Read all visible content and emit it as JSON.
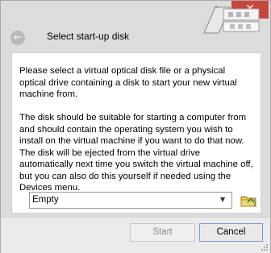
{
  "titlebar": {
    "help_label": "?",
    "close_label": "✕",
    "close_color": "#c7463d"
  },
  "header": {
    "back_icon": "back-arrow-icon",
    "title": "Select start-up disk"
  },
  "body": {
    "paragraph1": "Please select a virtual optical disk file or a physical optical drive containing a disk to start your new virtual machine from.",
    "paragraph2": "The disk should be suitable for starting a computer from and should contain the operating system you wish to install on the virtual machine if you want to do that now. The disk will be ejected from the virtual drive automatically next time you switch the virtual machine off, but you can also do this yourself if needed using the Devices menu."
  },
  "disk_select": {
    "selected": "Empty",
    "chooser_icon": "folder-icon"
  },
  "buttons": {
    "start_label": "Start",
    "cancel_label": "Cancel"
  }
}
